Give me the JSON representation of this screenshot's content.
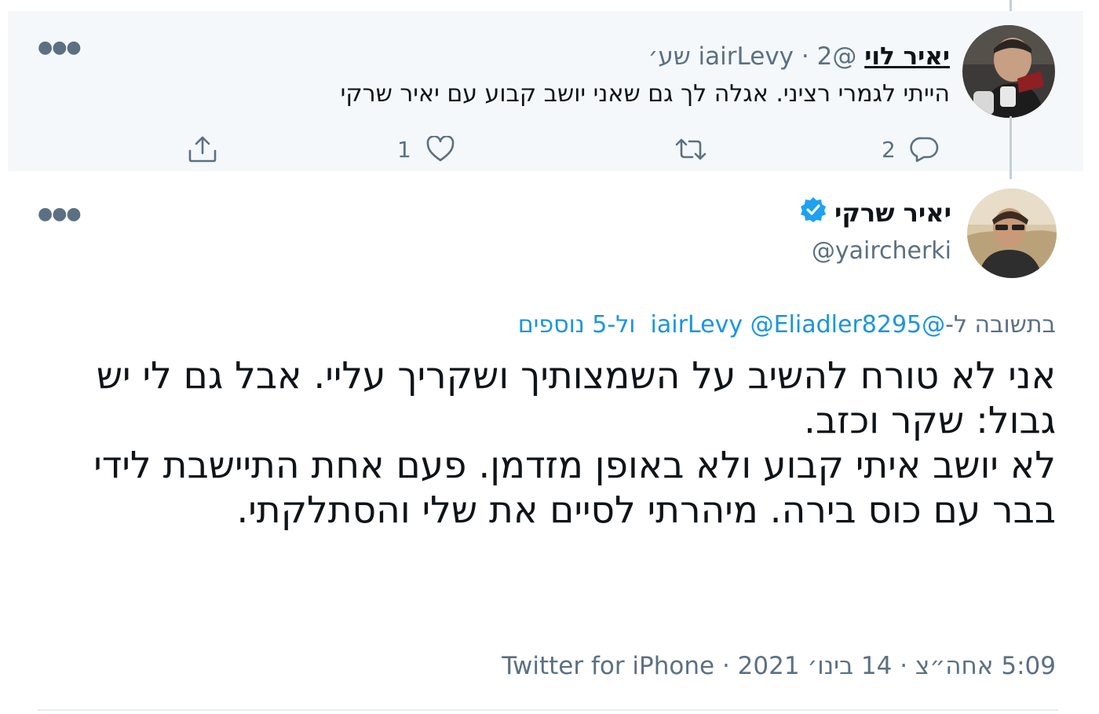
{
  "parent_tweet": {
    "display_name": "יאיר לוי",
    "handle": "@iairLevy",
    "separator": "·",
    "time": "2 שע׳",
    "text": "הייתי לגמרי רציני. אגלה לך גם שאני יושב קבוע עם יאיר שרקי",
    "actions": {
      "reply_count": "2",
      "retweet_count": "",
      "like_count": "1"
    },
    "more_icon": "more-horizontal-icon"
  },
  "main_tweet": {
    "display_name": "יאיר שרקי",
    "verified": true,
    "handle": "@yaircherki",
    "reply_prefix": "בתשובה ל-",
    "reply_mentions": "@iairLevy @Eliadler8295",
    "reply_more": "ול-5 נוספים",
    "text_lines": [
      "אני לא טורח להשיב על השמצותיך ושקריך עליי. אבל גם לי יש גבול: שקר וכזב.",
      "לא יושב איתי קבוע ולא באופן מזדמן. פעם אחת התיישבת לידי בבר עם כוס בירה. מיהרתי לסיים את שלי והסתלקתי."
    ],
    "meta": {
      "time": "5:09 אחה״צ",
      "date": "14 בינו׳ 2021",
      "separator": "·",
      "client": "Twitter for iPhone"
    }
  },
  "colors": {
    "link": "#1b95e0",
    "muted": "#5b7083",
    "verified": "#1da1f2",
    "parent_background": "#f5f8fa"
  }
}
